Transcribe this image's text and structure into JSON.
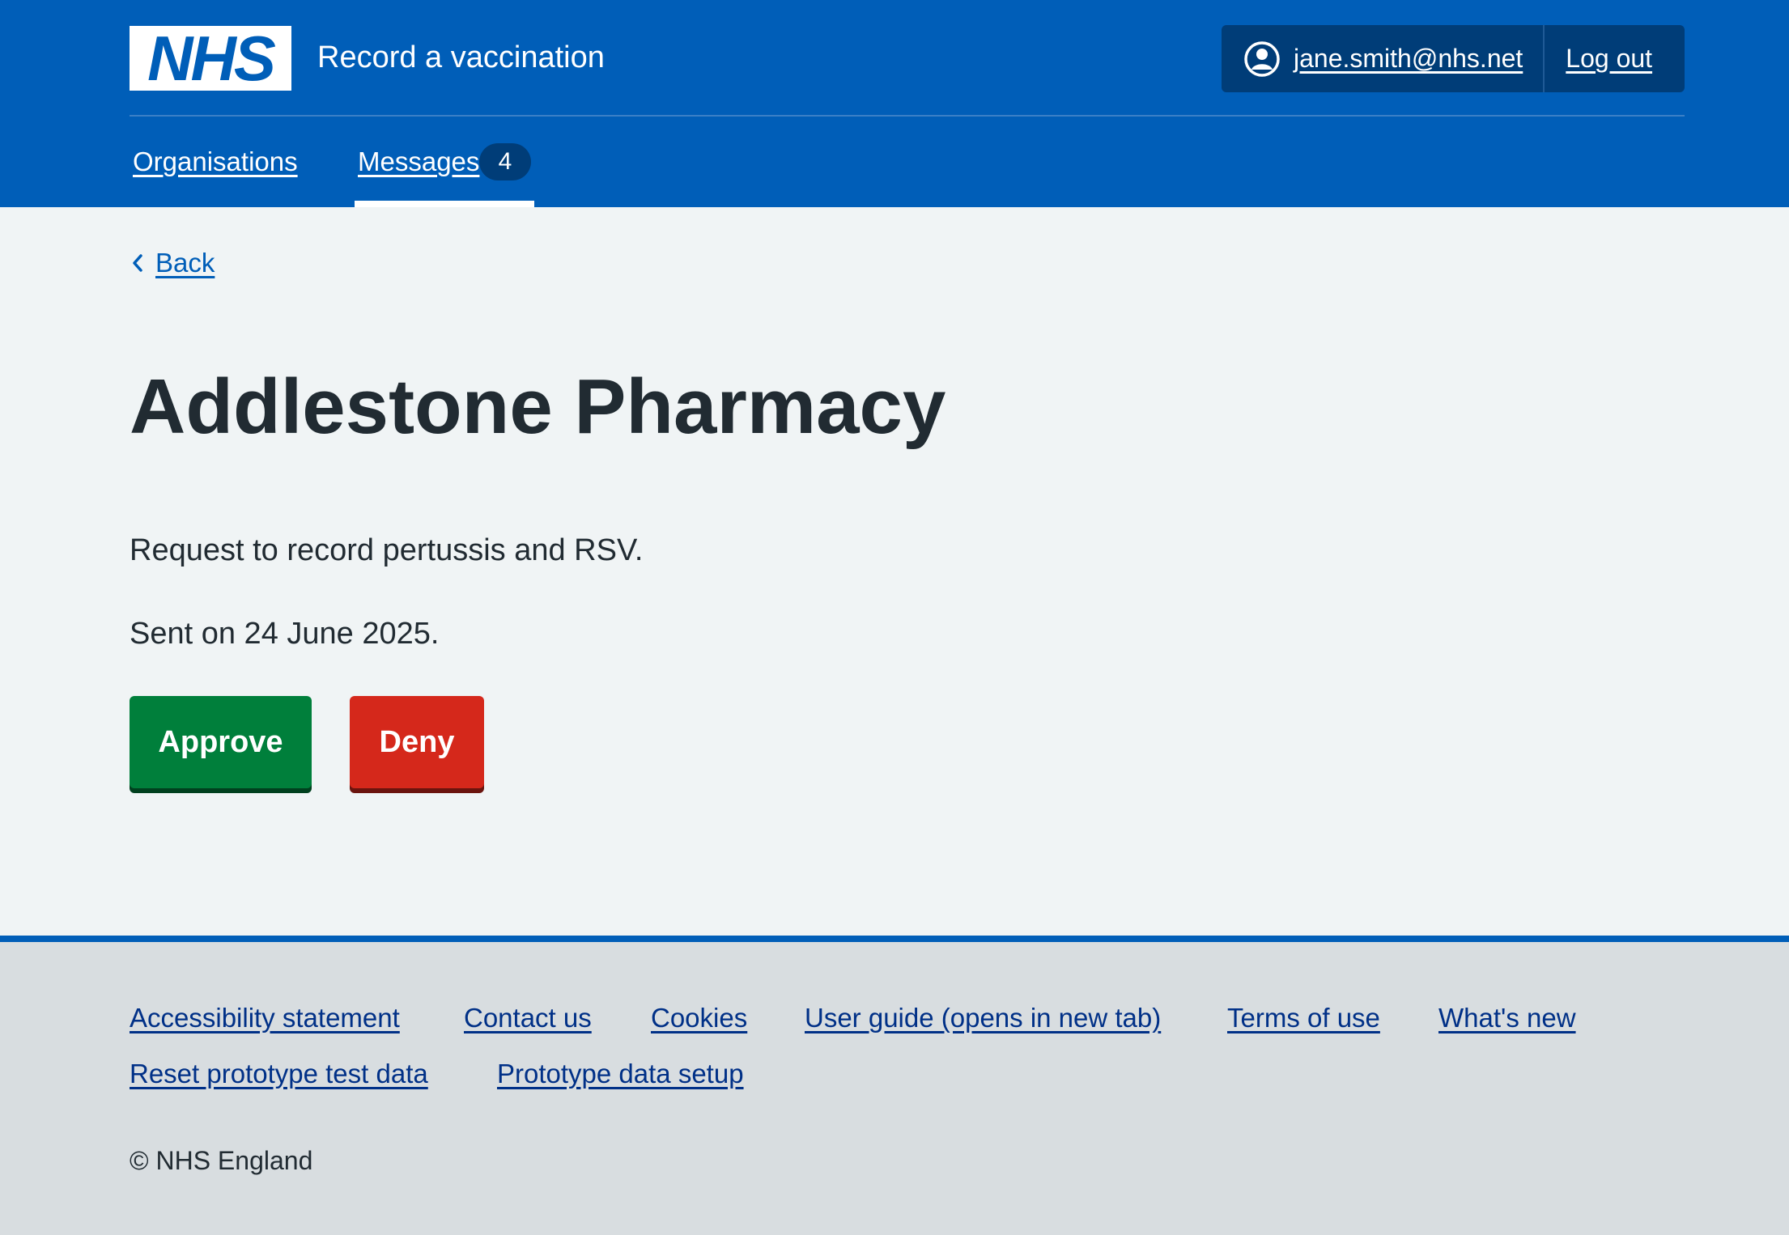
{
  "header": {
    "logo_text": "NHS",
    "service_name": "Record a vaccination",
    "account": {
      "email": "jane.smith@nhs.net",
      "logout_label": "Log out"
    },
    "nav": {
      "items": [
        {
          "label": "Organisations"
        },
        {
          "label": "Messages",
          "badge": "4",
          "active": true
        }
      ]
    }
  },
  "main": {
    "back_label": "Back",
    "title": "Addlestone Pharmacy",
    "request_text": "Request to record pertussis and RSV.",
    "sent_text": "Sent on 24 June 2025.",
    "buttons": {
      "approve_label": "Approve",
      "deny_label": "Deny"
    }
  },
  "footer": {
    "links": [
      "Accessibility statement",
      "Contact us",
      "Cookies",
      "User guide (opens in new tab)",
      "Terms of use",
      "What's new",
      "Reset prototype test data",
      "Prototype data setup"
    ],
    "copyright": "© NHS England"
  },
  "colors": {
    "brand_blue": "#005eb8",
    "dark_blue": "#003d78",
    "approve_green": "#007f3b",
    "deny_red": "#d5281b",
    "page_bg": "#f0f4f5",
    "footer_bg": "#d8dde0"
  },
  "icons": {
    "user": "user-circle-icon",
    "back": "chevron-left-icon"
  }
}
